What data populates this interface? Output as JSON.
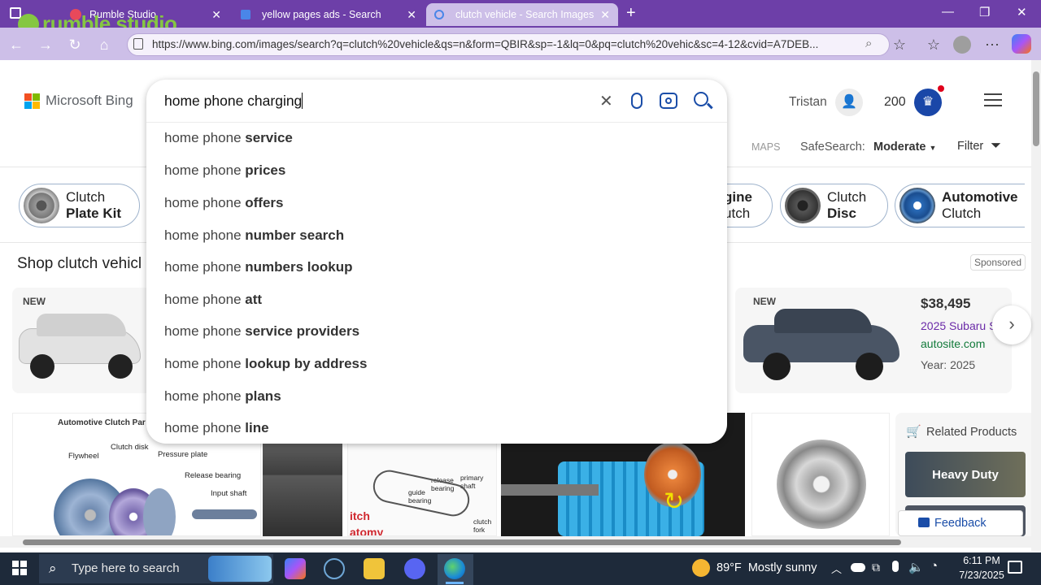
{
  "browser": {
    "tabs": [
      {
        "title": "Rumble Studio"
      },
      {
        "title": "yellow pages ads - Search"
      },
      {
        "title": "clutch vehicle - Search Images"
      }
    ],
    "url": "https://www.bing.com/images/search?q=clutch%20vehicle&qs=n&form=QBIR&sp=-1&lq=0&pq=clutch%20vehic&sc=4-12&cvid=A7DEB..."
  },
  "watermark": "rumble studio",
  "bing": {
    "logo_text": "Microsoft Bing",
    "query": "home phone charging",
    "user": "Tristan",
    "points": "200",
    "maps": "MAPS",
    "safesearch_label": "SafeSearch:",
    "safesearch_value": "Moderate",
    "filter": "Filter"
  },
  "suggestions": [
    {
      "prefix": "home phone ",
      "bold": "service"
    },
    {
      "prefix": "home phone ",
      "bold": "prices"
    },
    {
      "prefix": "home phone ",
      "bold": "offers"
    },
    {
      "prefix": "home phone ",
      "bold": "number search"
    },
    {
      "prefix": "home phone ",
      "bold": "numbers lookup"
    },
    {
      "prefix": "home phone ",
      "bold": "att"
    },
    {
      "prefix": "home phone ",
      "bold": "service providers"
    },
    {
      "prefix": "home phone ",
      "bold": "lookup by address"
    },
    {
      "prefix": "home phone ",
      "bold": "plans"
    },
    {
      "prefix": "home phone ",
      "bold": "line"
    }
  ],
  "chips": [
    {
      "line1": "Clutch",
      "line2": "Plate Kit"
    },
    {
      "line1": "gine",
      "line2": "utch"
    },
    {
      "line1": "Clutch",
      "line2": "Disc"
    },
    {
      "line1": "Automotive",
      "line2": "Clutch"
    }
  ],
  "shop": {
    "title": "Shop clutch vehicl",
    "sponsored": "Sponsored",
    "badge_new": "NEW",
    "badge_new2": "NEW",
    "price": "$38,495",
    "name": "2025 Subaru S",
    "site": "autosite.com",
    "year": "Year: 2025"
  },
  "images": {
    "diagram_title": "Automotive Clutch Par",
    "labels": [
      "Flywheel",
      "Clutch disk",
      "Pressure plate",
      "Release bearing",
      "Input shaft"
    ],
    "labels2": [
      "release bearing",
      "primary shaft",
      "guide bearing",
      "clutch fork"
    ],
    "red_text": [
      "itch",
      "atomy"
    ]
  },
  "related": {
    "title": "Related Products",
    "product": "Heavy Duty"
  },
  "feedback": "Feedback",
  "taskbar": {
    "search_placeholder": "Type here to search",
    "weather": "89°F  Mostly sunny",
    "time": "6:11 PM",
    "date": "7/23/2025"
  }
}
